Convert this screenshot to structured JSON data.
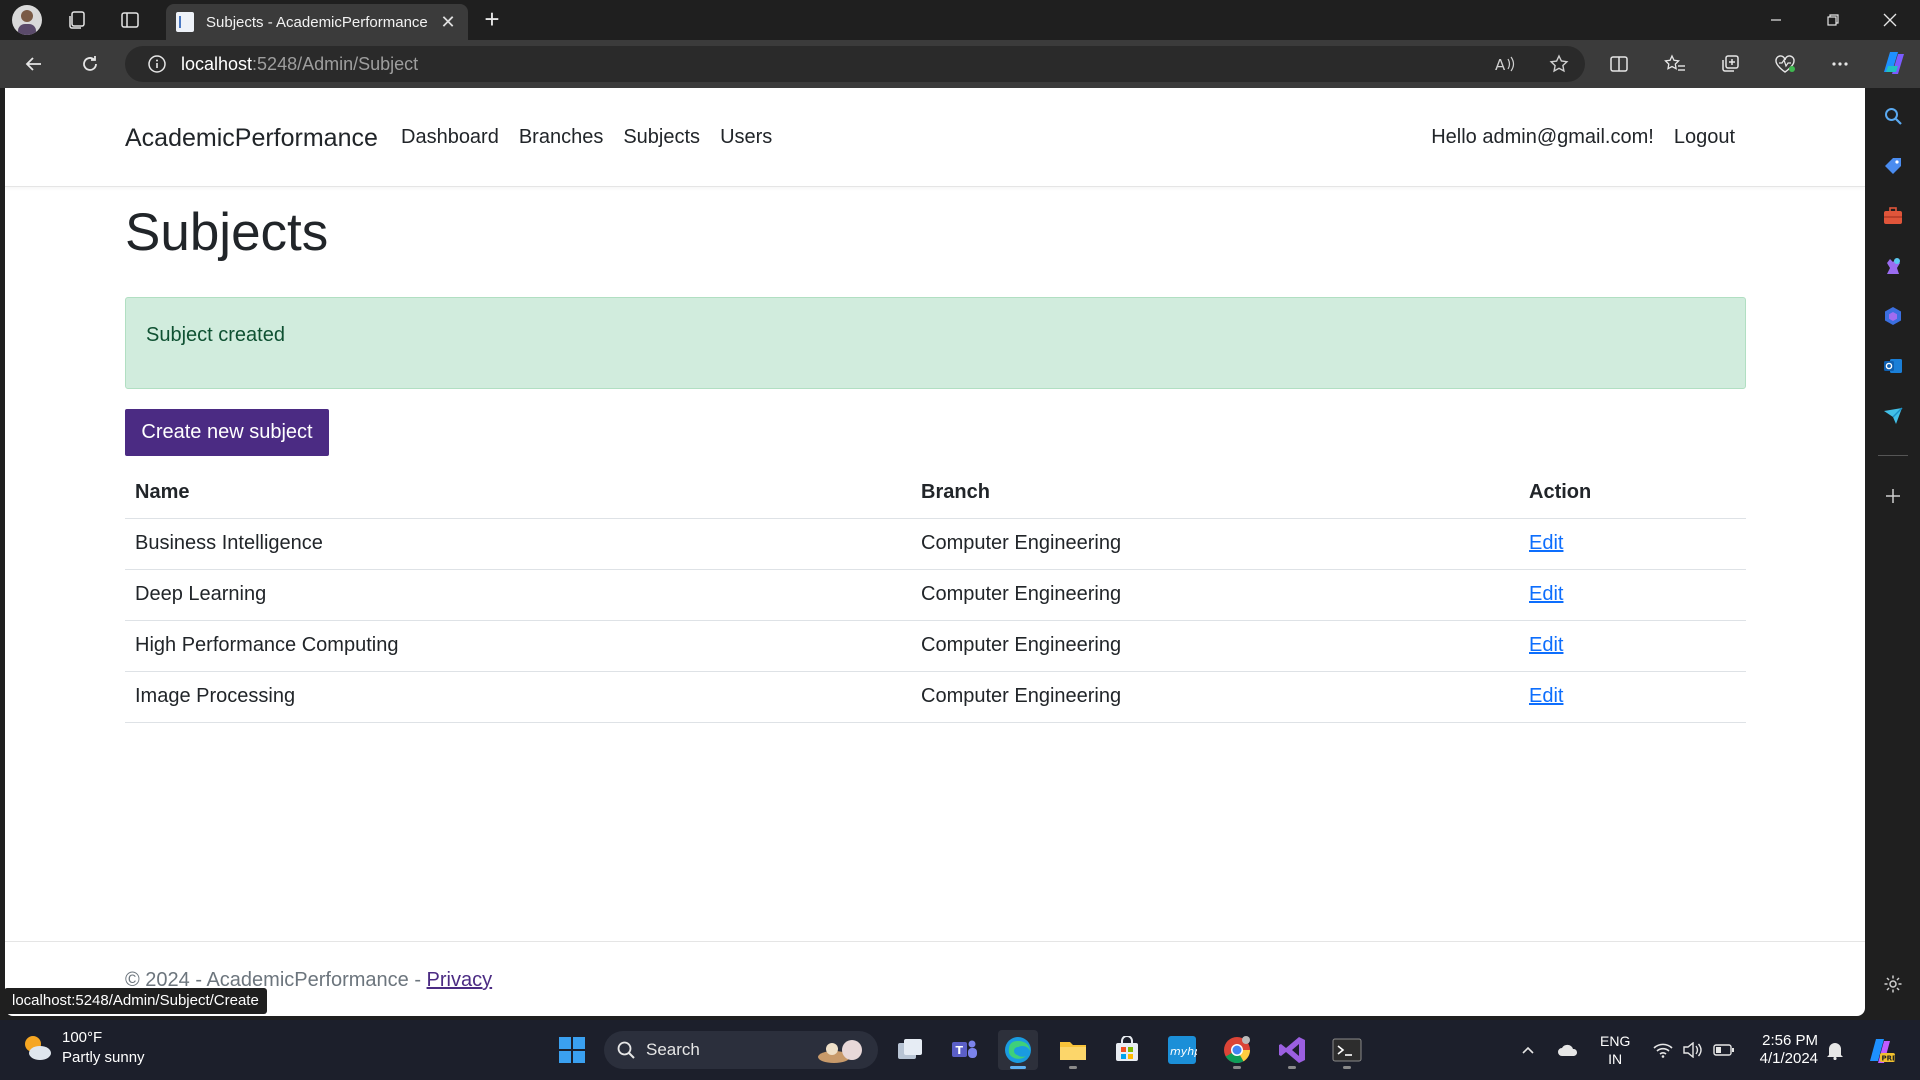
{
  "browser": {
    "tab_title": "Subjects - AcademicPerformance",
    "url_host": "localhost",
    "url_rest": ":5248/Admin/Subject",
    "status_url": "localhost:5248/Admin/Subject/Create"
  },
  "navbar": {
    "brand": "AcademicPerformance",
    "links": [
      "Dashboard",
      "Branches",
      "Subjects",
      "Users"
    ],
    "greeting": "Hello admin@gmail.com!",
    "logout": "Logout"
  },
  "main": {
    "title": "Subjects",
    "alert": "Subject created",
    "create_button": "Create new subject",
    "table": {
      "headers": [
        "Name",
        "Branch",
        "Action"
      ],
      "rows": [
        {
          "name": "Business Intelligence",
          "branch": "Computer Engineering",
          "action": "Edit"
        },
        {
          "name": "Deep Learning",
          "branch": "Computer Engineering",
          "action": "Edit"
        },
        {
          "name": "High Performance Computing",
          "branch": "Computer Engineering",
          "action": "Edit"
        },
        {
          "name": "Image Processing",
          "branch": "Computer Engineering",
          "action": "Edit"
        }
      ]
    }
  },
  "footer": {
    "text": "© 2024 - AcademicPerformance - ",
    "privacy": "Privacy"
  },
  "taskbar": {
    "weather_temp": "100°F",
    "weather_desc": "Partly sunny",
    "search_label": "Search",
    "lang_line1": "ENG",
    "lang_line2": "IN",
    "time": "2:56 PM",
    "date": "4/1/2024"
  },
  "colors": {
    "primary": "#4b2b83",
    "link": "#0d6efd",
    "alert_bg": "#d1ecdd",
    "alert_text": "#0f5132"
  }
}
